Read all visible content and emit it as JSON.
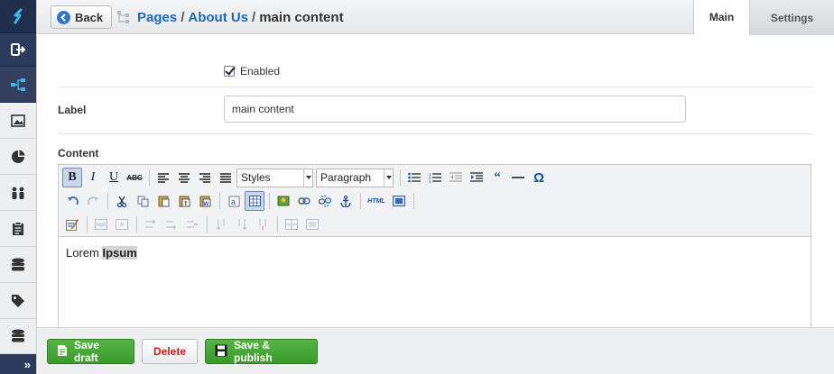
{
  "sidebar": {
    "icons": [
      "logo-icon",
      "logout-icon",
      "sitetree-icon",
      "image-icon",
      "pie-chart-icon",
      "users-icon",
      "clipboard-icon",
      "database-icon",
      "tag-icon",
      "database-stack-icon"
    ],
    "expand_label": "»",
    "active_color": "#33415f"
  },
  "header": {
    "back_label": "Back",
    "breadcrumbs": [
      "Pages",
      "About Us",
      "main content"
    ],
    "tabs": [
      {
        "label": "Main",
        "active": true
      },
      {
        "label": "Settings",
        "active": false
      }
    ]
  },
  "form": {
    "enabled_label": "Enabled",
    "enabled_checked": true,
    "label_field_label": "Label",
    "label_value": "main content",
    "content_label": "Content"
  },
  "editor": {
    "styles_select": "Styles",
    "format_select": "Paragraph",
    "body_text": "Lorem",
    "body_highlight": "Ipsum",
    "html_button": "HTML"
  },
  "footer": {
    "save_draft": "Save draft",
    "delete": "Delete",
    "save_publish": "Save & publish"
  },
  "colors": {
    "accent_blue": "#1b6ab9",
    "green": "#3b9a2c",
    "delete_red": "#cc1e1e",
    "sidebar_dark": "#1f2f4c"
  }
}
